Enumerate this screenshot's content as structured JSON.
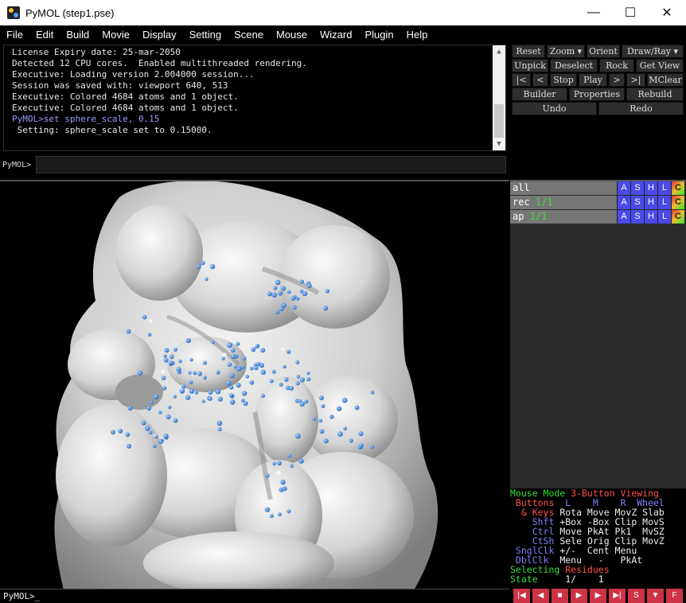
{
  "window": {
    "title": "PyMOL (step1.pse)",
    "minimize_icon": "minimize-icon",
    "maximize_icon": "maximize-icon",
    "close_icon": "close-icon"
  },
  "menu": [
    "File",
    "Edit",
    "Build",
    "Movie",
    "Display",
    "Setting",
    "Scene",
    "Mouse",
    "Wizard",
    "Plugin",
    "Help"
  ],
  "console": {
    "lines": [
      {
        "text": "License Expiry date: 25-mar-2050",
        "type": "out"
      },
      {
        "text": "Detected 12 CPU cores.  Enabled multithreaded rendering.",
        "type": "out"
      },
      {
        "text": "Executive: Loading version 2.004000 session...",
        "type": "out"
      },
      {
        "text": "Session was saved with: viewport 640, 513",
        "type": "out"
      },
      {
        "text": "Executive: Colored 4684 atoms and 1 object.",
        "type": "out"
      },
      {
        "text": "Executive: Colored 4684 atoms and 1 object.",
        "type": "out"
      },
      {
        "text": "PyMOL>set sphere_scale, 0.15",
        "type": "cmd"
      },
      {
        "text": " Setting: sphere_scale set to 0.15000.",
        "type": "out"
      }
    ]
  },
  "cmdline": {
    "label": "PyMOL>",
    "value": ""
  },
  "bottom_prompt": "PyMOL>_",
  "buttons": {
    "row1": [
      "Reset",
      "Zoom ▾",
      "Orient",
      "Draw/Ray ▾"
    ],
    "row2": [
      "Unpick",
      "Deselect",
      "Rock",
      "Get View"
    ],
    "row3": [
      "|<",
      "<",
      "Stop",
      "Play",
      ">",
      ">|",
      "MClear"
    ],
    "row4": [
      "Builder",
      "Properties",
      "Rebuild"
    ],
    "row5": [
      "Undo",
      "Redo"
    ]
  },
  "objects": [
    {
      "name": "all",
      "count": ""
    },
    {
      "name": "rec",
      "count": "1/1"
    },
    {
      "name": "ap",
      "count": "1/1"
    }
  ],
  "obj_buttons": [
    "A",
    "S",
    "H",
    "L",
    "C"
  ],
  "mouse_info": {
    "line1_a": "Mouse Mode ",
    "line1_b": "3-Button Viewing",
    "line2_a": " Buttons ",
    "line2_b": " L    M    R  Wheel",
    "line3_a": "  & Keys ",
    "line3_b": "Rota Move MovZ Slab",
    "line4_a": "    Shft ",
    "line4_b": "+Box -Box Clip MovS",
    "line5_a": "    Ctrl ",
    "line5_b": "Move PkAt Pk1  MvSZ",
    "line6_a": "    CtSh ",
    "line6_b": "Sele Orig Clip MovZ",
    "line7_a": " SnglClk ",
    "line7_b": "+/-  Cent Menu",
    "line8_a": " DblClk ",
    "line8_b": " Menu   -   PkAt",
    "line9_a": "Selecting ",
    "line9_b": "Residues",
    "line10_a": "State ",
    "line10_b": "    1/    1"
  },
  "playbar": [
    "|◀",
    "◀",
    "■",
    "▶",
    "▶",
    "▶|",
    "S",
    "▼",
    "F"
  ],
  "colors": {
    "atom": "#4a8fe0",
    "surface": "#d8d8d8",
    "object_button": "#4a4ae8",
    "playbar": "#cc3344"
  }
}
